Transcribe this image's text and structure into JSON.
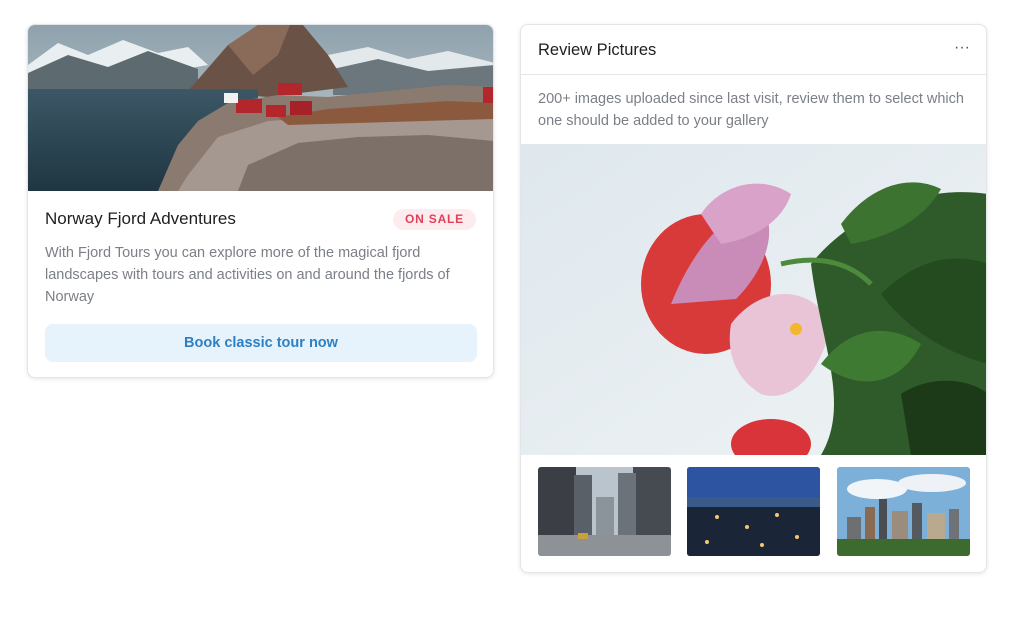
{
  "fjord_card": {
    "title": "Norway Fjord Adventures",
    "badge": "ON SALE",
    "description": "With Fjord Tours you can explore more of the magical fjord landscapes with tours and activities on and around the fjords of Norway",
    "button_label": "Book classic tour now",
    "image_icon": "fjord-landscape-photo"
  },
  "review_card": {
    "title": "Review Pictures",
    "more_icon": "ellipsis-icon",
    "more_label": "···",
    "description": "200+ images uploaded since last visit, review them to select which one should be added to your gallery",
    "main_image_icon": "flower-photo",
    "thumbnails": [
      {
        "icon": "city-street-photo"
      },
      {
        "icon": "city-night-photo"
      },
      {
        "icon": "city-skyline-photo"
      }
    ]
  },
  "colors": {
    "badge_bg": "#fdecee",
    "badge_text": "#e0415a",
    "button_bg": "#e6f3fc",
    "button_text": "#2f80c2"
  }
}
